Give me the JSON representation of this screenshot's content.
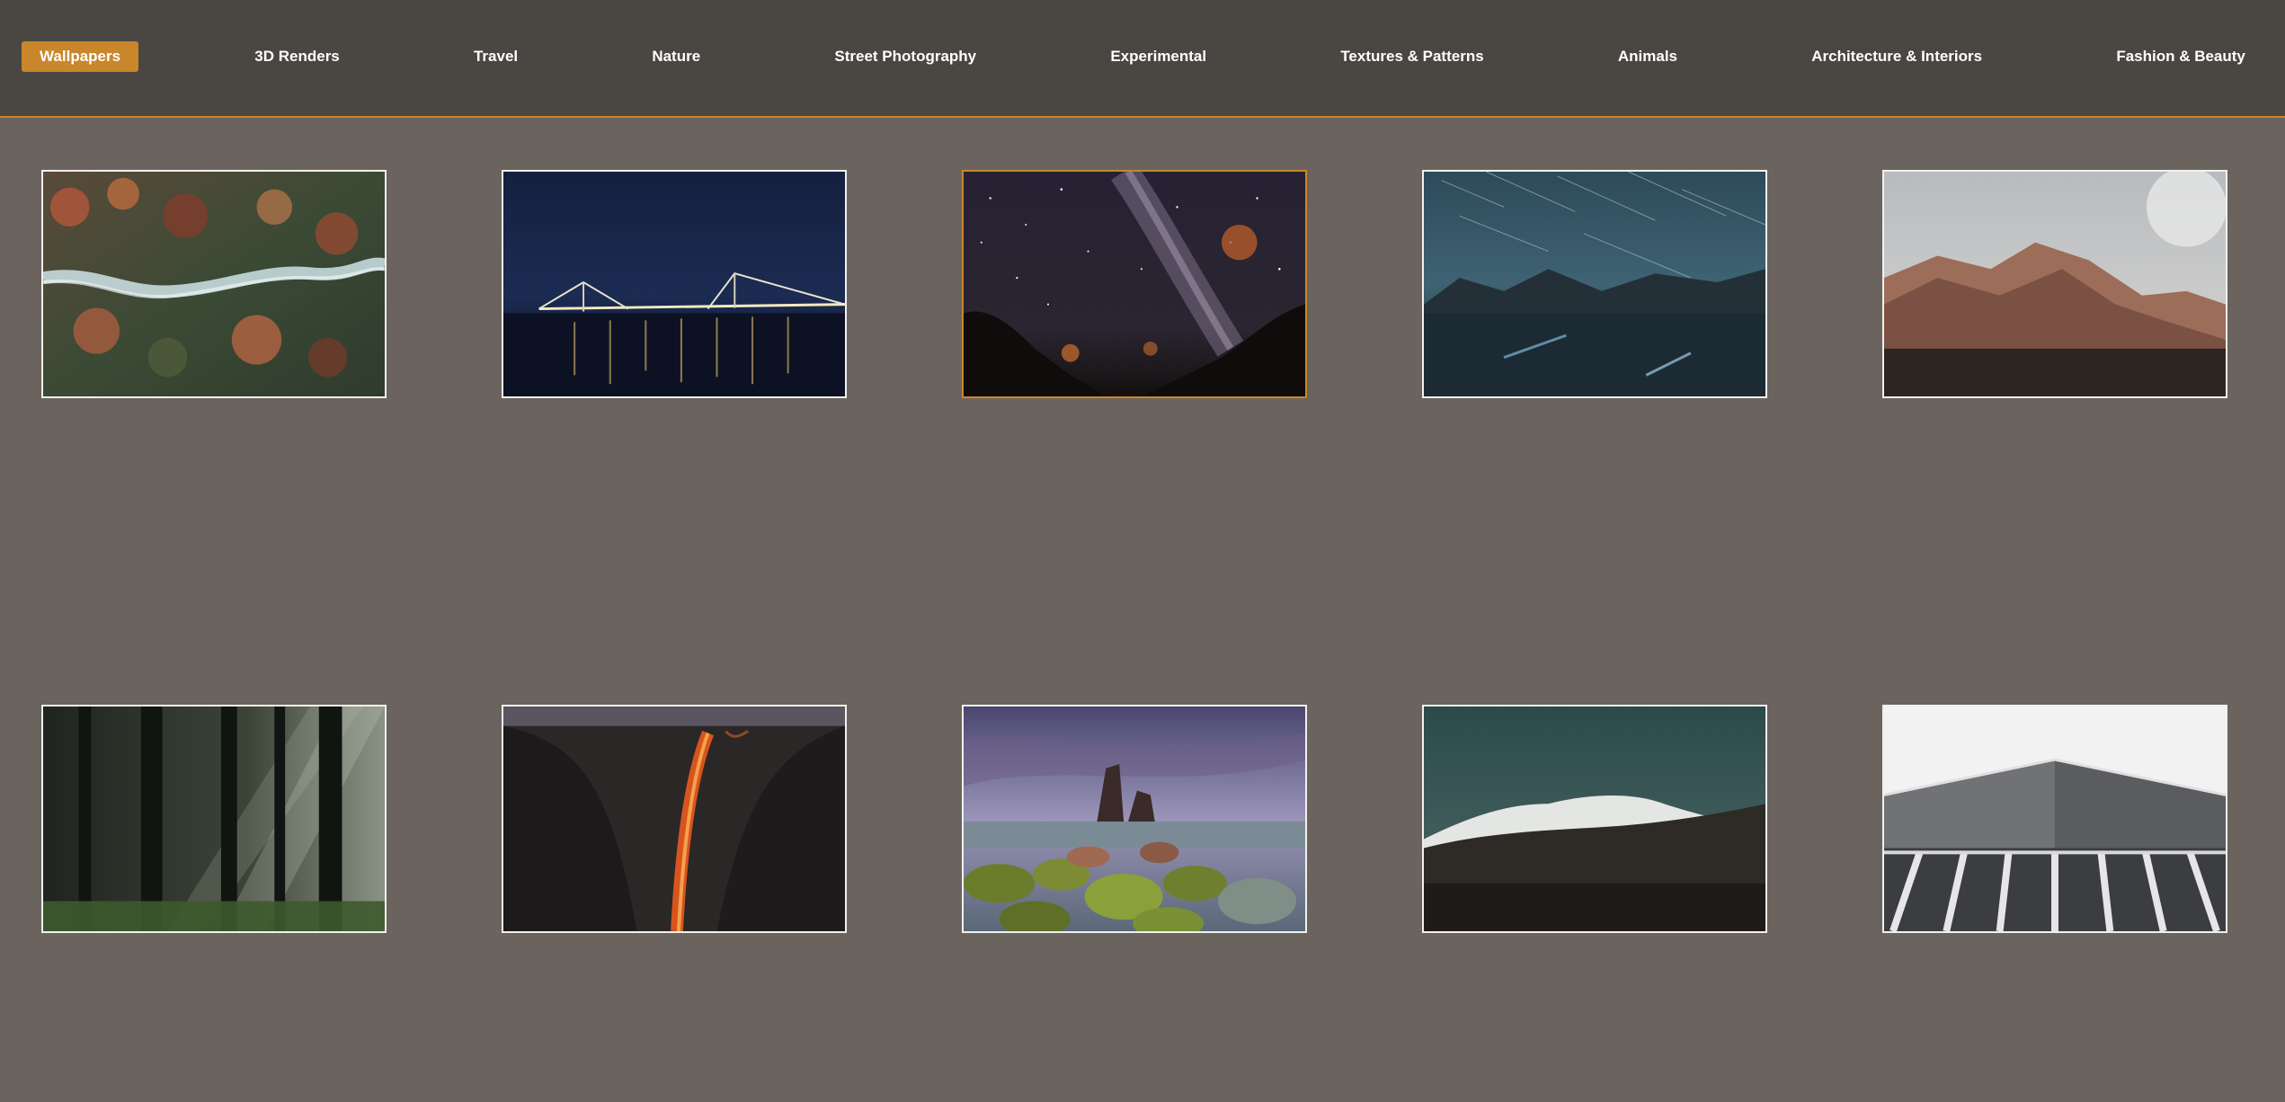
{
  "nav": {
    "items": [
      {
        "label": "Wallpapers",
        "active": true
      },
      {
        "label": "3D Renders"
      },
      {
        "label": "Travel"
      },
      {
        "label": "Nature"
      },
      {
        "label": "Street Photography"
      },
      {
        "label": "Experimental"
      },
      {
        "label": "Textures & Patterns"
      },
      {
        "label": "Animals"
      },
      {
        "label": "Architecture & Interiors"
      },
      {
        "label": "Fashion & Beauty"
      }
    ]
  },
  "colors": {
    "accent": "#c9862a",
    "header_bg": "#4a4743",
    "page_bg": "#6b645e",
    "tile_border": "#f2f0ee"
  },
  "gallery": {
    "selected_index": 2,
    "photos": [
      {
        "subject": "aerial-autumn-forest-river"
      },
      {
        "subject": "night-bridge-lights"
      },
      {
        "subject": "milky-way-night-sky"
      },
      {
        "subject": "star-trails-mountain-lake"
      },
      {
        "subject": "rocky-mountain-peak"
      },
      {
        "subject": "sunlit-misty-forest"
      },
      {
        "subject": "firefall-waterfall-cliff"
      },
      {
        "subject": "mossy-boulders-sea-stacks"
      },
      {
        "subject": "snowy-mountain-dusk"
      },
      {
        "subject": "modern-roof-architecture"
      }
    ]
  }
}
